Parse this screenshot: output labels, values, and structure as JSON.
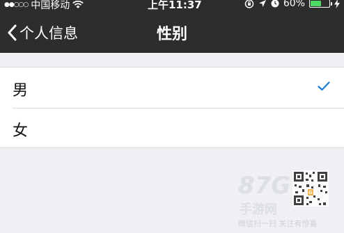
{
  "status_bar": {
    "signal": "●●○○○",
    "carrier": "中国移动",
    "time": "上午11:37",
    "battery_percent": "60%",
    "battery_level": 0.6
  },
  "nav": {
    "back_label": "个人信息",
    "title": "性别"
  },
  "gender_options": [
    {
      "label": "男",
      "selected": true
    },
    {
      "label": "女",
      "selected": false
    }
  ],
  "watermark": {
    "logo": "87G",
    "sub": "手游网",
    "caption": "微信扫一扫 关注有惊喜"
  },
  "colors": {
    "nav_bg": "#2d2d2d",
    "page_bg": "#efeff4",
    "check": "#1a7bd6",
    "battery": "#4cd964"
  }
}
